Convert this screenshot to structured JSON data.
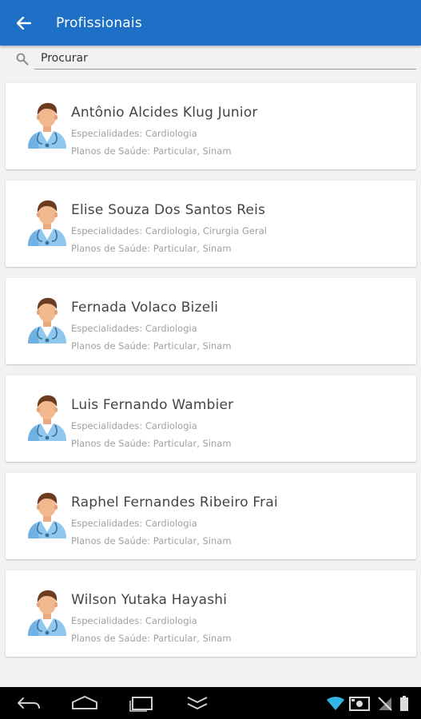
{
  "appbar": {
    "title": "Profissionais",
    "back_icon": "arrow-left-icon",
    "color": "#1e6fc6"
  },
  "search": {
    "placeholder": "Procurar",
    "value": "",
    "icon": "search-icon"
  },
  "professionals": [
    {
      "name": "Antônio Alcides Klug Junior",
      "specialties": "Especialidades: Cardiologia",
      "plans": "Planos de Saúde: Particular, Sinam"
    },
    {
      "name": "Elise Souza Dos Santos Reis",
      "specialties": "Especialidades: Cardiologia, Cirurgia Geral",
      "plans": "Planos de Saúde: Particular, Sinam"
    },
    {
      "name": "Fernada Volaco Bizeli",
      "specialties": "Especialidades: Cardiologia",
      "plans": "Planos de Saúde: Particular, Sinam"
    },
    {
      "name": "Luis Fernando Wambier",
      "specialties": "Especialidades: Cardiologia",
      "plans": "Planos de Saúde: Particular, Sinam"
    },
    {
      "name": "Raphel Fernandes Ribeiro Frai",
      "specialties": "Especialidades: Cardiologia",
      "plans": "Planos de Saúde: Particular, Sinam"
    },
    {
      "name": "Wilson Yutaka Hayashi",
      "specialties": "Especialidades: Cardiologia",
      "plans": "Planos de Saúde: Particular, Sinam"
    }
  ],
  "avatar_icon": "doctor-avatar-icon",
  "navbar": {
    "buttons": [
      "back-nav-icon",
      "home-nav-icon",
      "recent-apps-nav-icon",
      "menu-nav-icon"
    ],
    "status_icons": [
      "wifi-icon",
      "screenshot-icon",
      "no-signal-icon",
      "battery-icon"
    ],
    "wifi_color": "#33b5e5"
  }
}
